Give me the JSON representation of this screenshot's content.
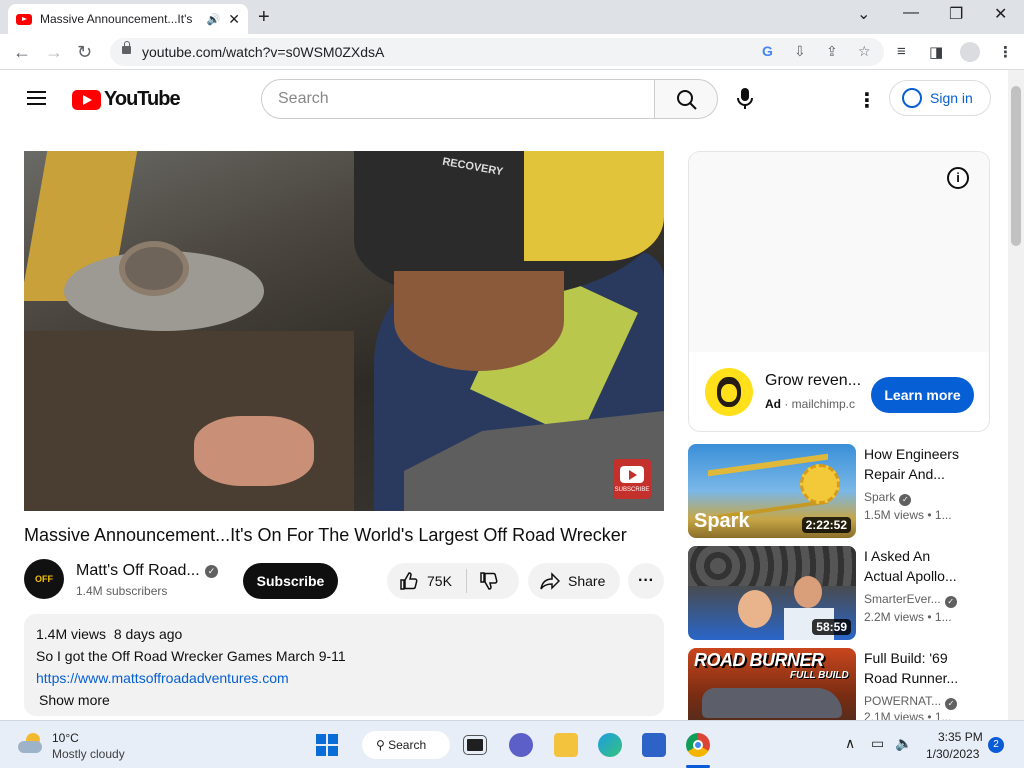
{
  "browser": {
    "tab_title": "Massive Announcement...It's",
    "url": "youtube.com/watch?v=s0WSM0ZXdsA"
  },
  "header": {
    "logo_text": "YouTube",
    "search_placeholder": "Search",
    "signin_label": "Sign in"
  },
  "video": {
    "title": "Massive Announcement...It's On For The World's Largest Off Road Wrecker",
    "channel_name": "Matt's Off Road...",
    "channel_avatar_text": "OFF ROAD",
    "subscribers": "1.4M subscribers",
    "subscribe_label": "Subscribe",
    "likes": "75K",
    "share_label": "Share",
    "watermark_text": "SUBSCRIBE",
    "cap_text": "RECOVERY"
  },
  "description": {
    "views": "1.4M views",
    "date": "8 days ago",
    "line1": "So I got the Off Road Wrecker Games March 9-11",
    "link": "https://www.mattsoffroadadventures.com",
    "show_more": "Show more"
  },
  "ad": {
    "title": "Grow reven...",
    "ad_label": "Ad",
    "domain": "mailchimp.c",
    "cta": "Learn more"
  },
  "recommendations": [
    {
      "title": "How Engineers Repair And...",
      "channel": "Spark",
      "views": "1.5M views",
      "age": "1...",
      "duration": "2:22:52",
      "thumb_text": "Spark"
    },
    {
      "title": "I Asked An Actual Apollo...",
      "channel": "SmarterEver...",
      "views": "2.2M views",
      "age": "1...",
      "duration": "58:59",
      "thumb_text": ""
    },
    {
      "title": "Full Build: '69 Road Runner...",
      "channel": "POWERNAT...",
      "views": "2.1M views",
      "age": "1...",
      "duration": "",
      "thumb_text": "ROAD BURNER",
      "thumb_sub": "FULL BUILD"
    }
  ],
  "taskbar": {
    "temp": "10°C",
    "weather": "Mostly cloudy",
    "search_label": "Search",
    "time": "3:35 PM",
    "date": "1/30/2023",
    "notifications": "2"
  }
}
